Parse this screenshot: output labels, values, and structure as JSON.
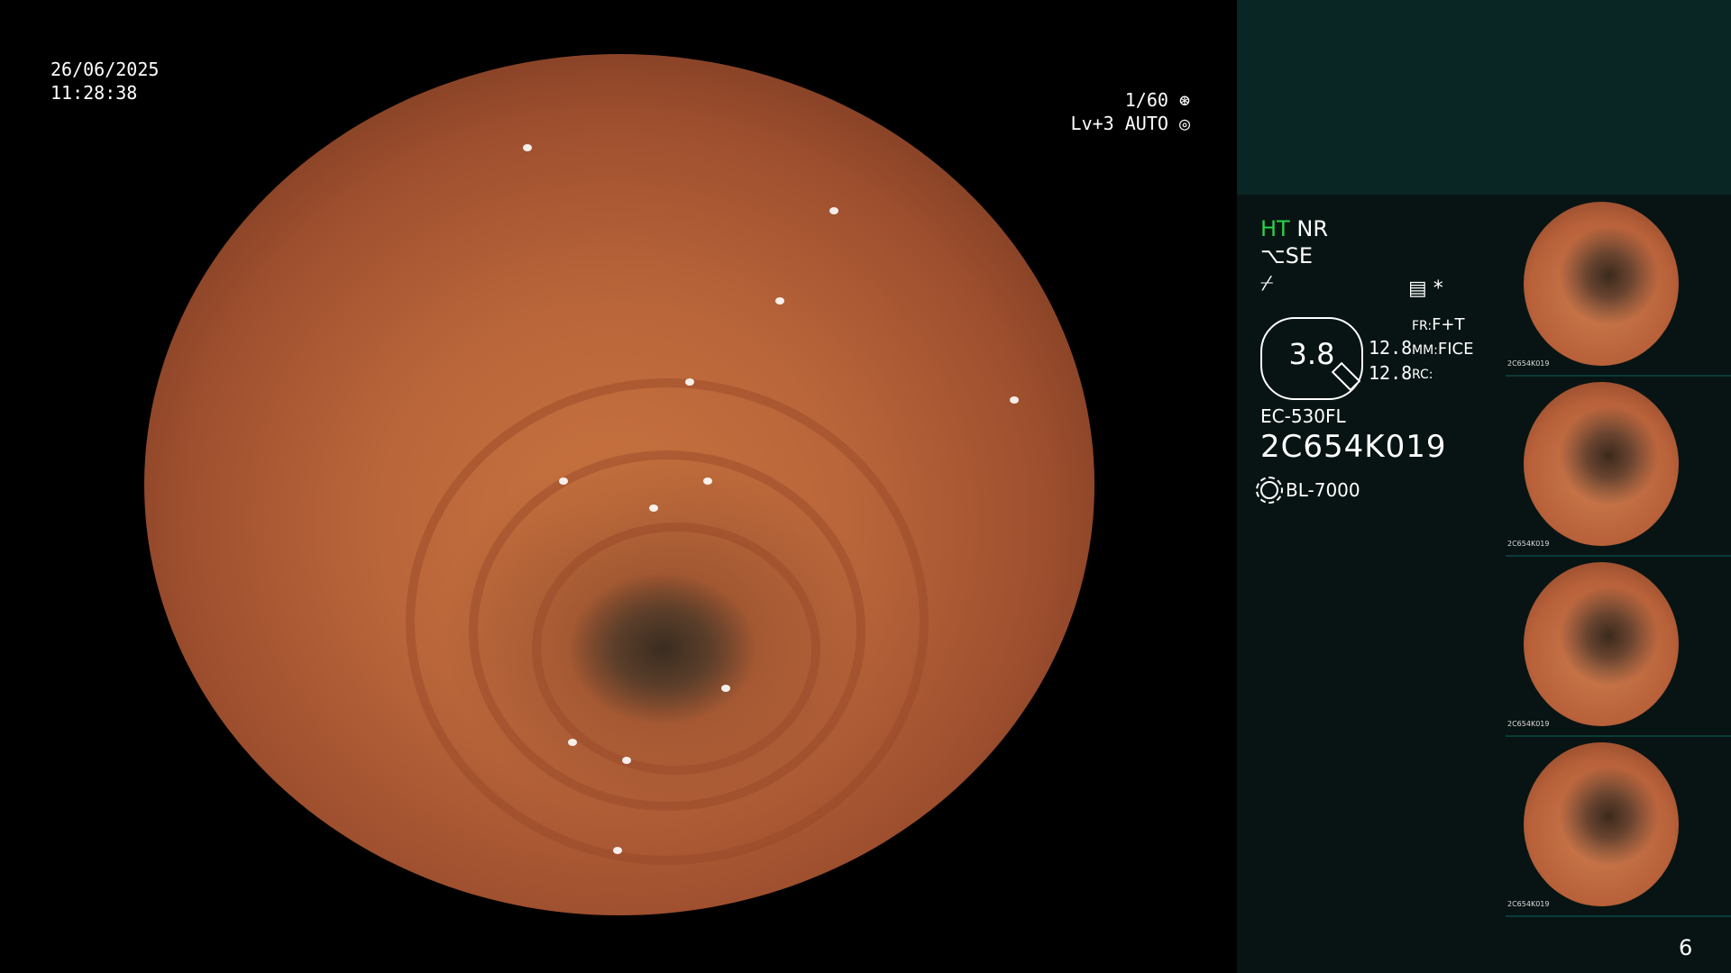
{
  "timestamp": {
    "date": "26/06/2025",
    "time": "11:28:38"
  },
  "exposure": {
    "shutter": "1/60",
    "level": "Lv+3 AUTO"
  },
  "status": {
    "ht": "HT",
    "nr": "NR",
    "se": "SE",
    "gauge_value": "3.8",
    "val1": "12.8",
    "val2": "12.8",
    "fr_label": "FR:",
    "fr_value": "F+T",
    "mm_label": "MM:",
    "mm_value": "FICE",
    "rc_label": "RC:",
    "asterisk": "*"
  },
  "scope": {
    "model": "EC-530FL",
    "serial": "2C654K019",
    "light_source": "BL-7000"
  },
  "thumbnails": [
    {
      "code": "2C654K019"
    },
    {
      "code": "2C654K019"
    },
    {
      "code": "2C654K019"
    },
    {
      "code": "2C654K019"
    }
  ],
  "page_number": "6",
  "colors": {
    "ht_green": "#2bd24a",
    "panel_bg": "#081413",
    "panel_top": "#0a2624"
  }
}
